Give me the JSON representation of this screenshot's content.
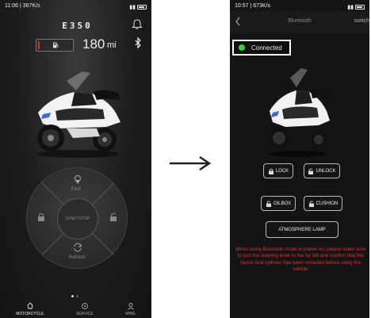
{
  "left": {
    "status_time": "11:06 | 367K/s",
    "logo_text": "E350",
    "range_value": "180",
    "range_unit": "mi",
    "control": {
      "find_label": "Find",
      "center_label": "START/STOP",
      "refresh_label": "Refresh"
    },
    "nav": [
      {
        "label": "MOTORCYCLE",
        "icon": "motorcycle-icon",
        "active": true
      },
      {
        "label": "SERVICE",
        "icon": "service-icon",
        "active": false
      },
      {
        "label": "MINE",
        "icon": "user-icon",
        "active": false
      }
    ],
    "page_dots": 2,
    "active_dot": 0
  },
  "right": {
    "status_time": "10:57 | 673K/s",
    "title": "Bluetooth",
    "switch_label": "switch",
    "connection_status": "Connected",
    "buttons": {
      "lock": "LOCK",
      "unlock": "UNLOCK",
      "oilbox": "OILBOX",
      "cushion": "CUSHION",
      "atmosphere": "ATMOSPHERE LAMP"
    },
    "warning": "When using Bluetooth mode to power on, please make sure to turn the steering lever to the far left and confirm that the faucet lock cylinder has been retracted before using the vehicle"
  },
  "colors": {
    "connected": "#2ed62e",
    "warning": "#e03030",
    "range_bar": "#e02b2b"
  }
}
